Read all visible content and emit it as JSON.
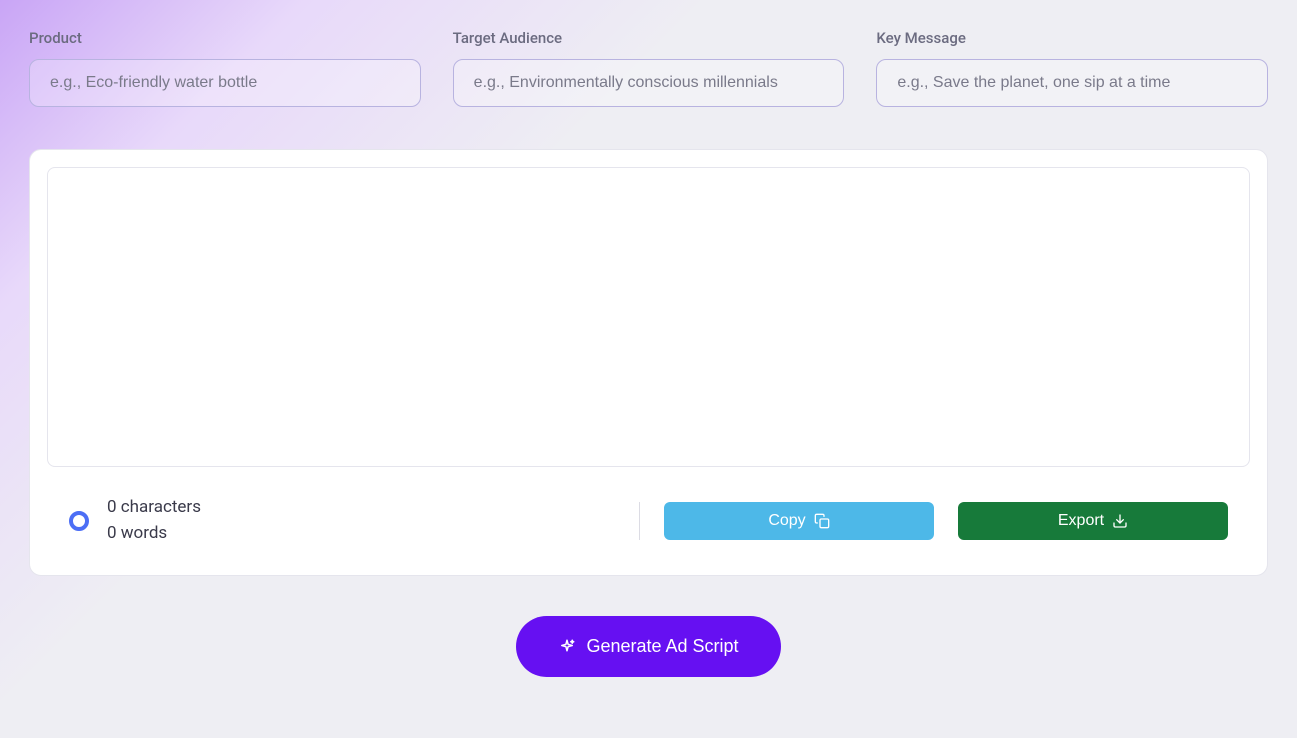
{
  "inputs": {
    "product": {
      "label": "Product",
      "placeholder": "e.g., Eco-friendly water bottle",
      "value": ""
    },
    "targetAudience": {
      "label": "Target Audience",
      "placeholder": "e.g., Environmentally conscious millennials",
      "value": ""
    },
    "keyMessage": {
      "label": "Key Message",
      "placeholder": "e.g., Save the planet, one sip at a time",
      "value": ""
    }
  },
  "output": {
    "value": "",
    "stats": {
      "characters": "0 characters",
      "words": "0 words"
    }
  },
  "actions": {
    "copy": "Copy",
    "export": "Export",
    "generate": "Generate Ad Script"
  }
}
